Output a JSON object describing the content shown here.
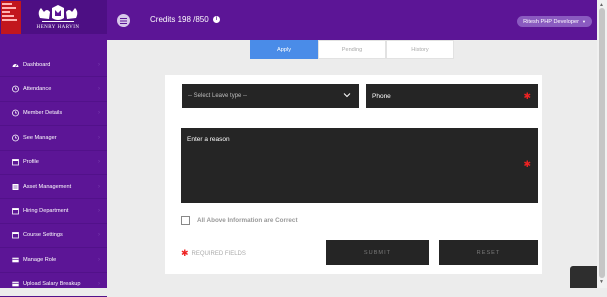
{
  "brand": {
    "badge_text": "Grand\nHarvard\nTri\nMark\nCertified",
    "logo_text": "HENRY HARVIN"
  },
  "sidebar": {
    "items": [
      {
        "label": "Dashboard",
        "icon": "tachometer-icon"
      },
      {
        "label": "Attendance",
        "icon": "clock-icon"
      },
      {
        "label": "Member Details",
        "icon": "clock-icon"
      },
      {
        "label": "See Manager",
        "icon": "clock-icon"
      },
      {
        "label": "Profile",
        "icon": "calendar-icon"
      },
      {
        "label": "Asset Management",
        "icon": "list-icon"
      },
      {
        "label": "Hiring Department",
        "icon": "calendar-icon"
      },
      {
        "label": "Course Settings",
        "icon": "calendar-icon"
      },
      {
        "label": "Manage Role",
        "icon": "card-icon"
      },
      {
        "label": "Upload Salary Breakup",
        "icon": "card-icon"
      }
    ]
  },
  "header": {
    "credits": "Credits 198 /850",
    "user": "Ritesh PHP Developer"
  },
  "tabs": [
    {
      "label": "Apply",
      "active": true
    },
    {
      "label": "Pending",
      "active": false
    },
    {
      "label": "History",
      "active": false
    }
  ],
  "form": {
    "leave_select": "-- Select Leave type --",
    "phone_placeholder": "Phone",
    "reason_placeholder": "Enter a reason",
    "confirm_label": "All Above Information are Correct",
    "required_text": "REQUIRED FIELDS",
    "submit_label": "SUBMIT",
    "reset_label": "RESET"
  },
  "colors": {
    "brand_purple": "#5c1596",
    "accent_blue": "#4a8ce8",
    "required_red": "#e22222",
    "field_dark": "#252525"
  }
}
